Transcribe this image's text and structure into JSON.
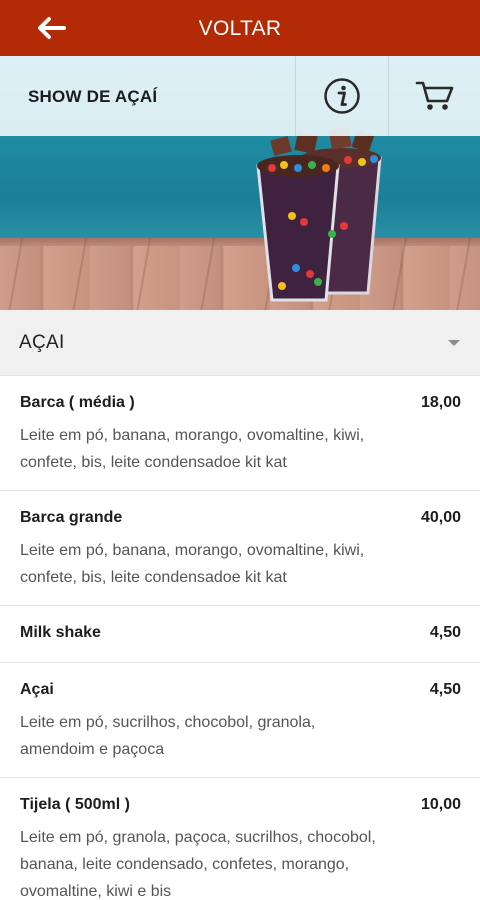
{
  "topbar": {
    "title": "VOLTAR",
    "back_icon": "arrow-left-icon"
  },
  "store": {
    "name": "SHOW DE AÇAÍ",
    "info_icon": "info-circle-icon",
    "cart_icon": "cart-icon"
  },
  "category": {
    "title": "AÇAI",
    "caret_icon": "caret-down-icon"
  },
  "items": [
    {
      "name": "Barca ( média )",
      "price": "18,00",
      "description": "Leite em pó, banana, morango, ovomaltine, kiwi, confete, bis, leite condensadoe kit kat"
    },
    {
      "name": "Barca grande",
      "price": "40,00",
      "description": "Leite em pó, banana, morango, ovomaltine, kiwi, confete, bis, leite condensadoe kit kat"
    },
    {
      "name": "Milk shake",
      "price": "4,50",
      "description": ""
    },
    {
      "name": "Açai",
      "price": "4,50",
      "description": "Leite em pó, sucrilhos, chocobol, granola, amendoim e paçoca"
    },
    {
      "name": "Tijela ( 500ml )",
      "price": "10,00",
      "description": "Leite em pó, granola, paçoca, sucrilhos, chocobol, banana, leite condensado, confetes, morango, ovomaltine, kiwi e bis"
    }
  ],
  "colors": {
    "topbar": "#b32a06",
    "header_bar": "#e8f4f7",
    "category_bar": "#f0f0f0"
  }
}
